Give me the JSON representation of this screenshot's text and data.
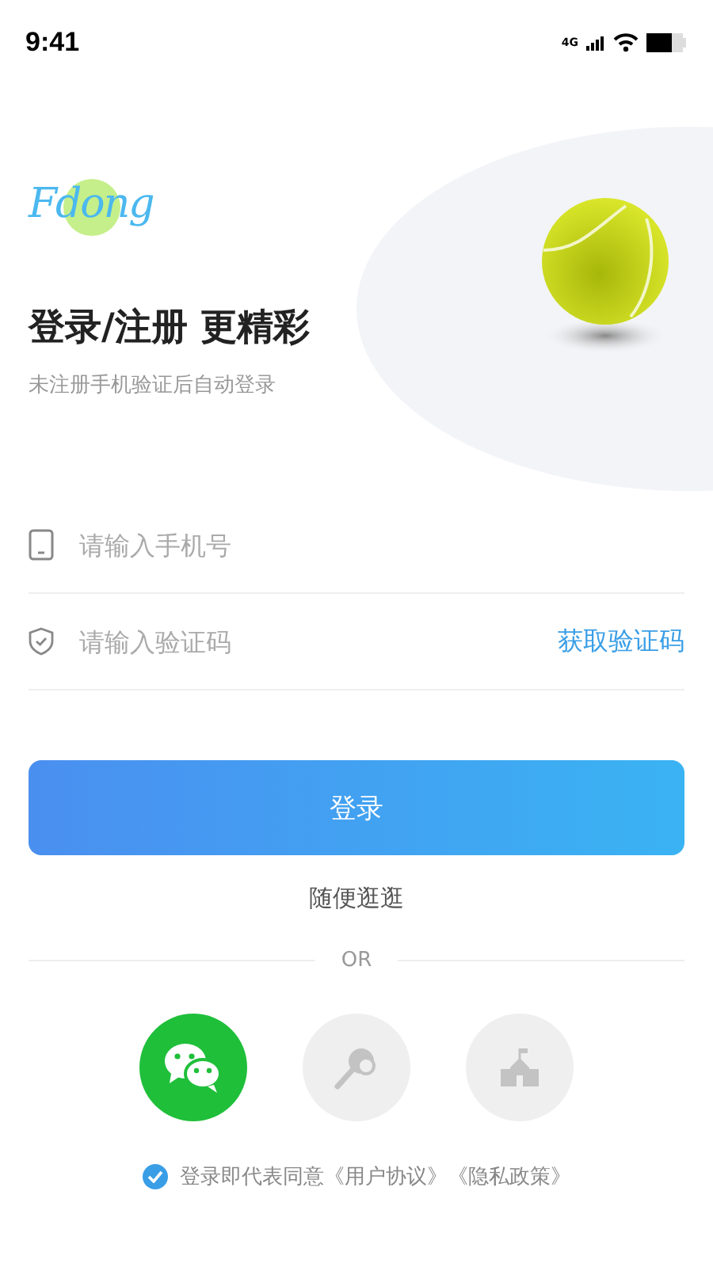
{
  "status_bar": {
    "time": "9:41",
    "network": "4G"
  },
  "logo": {
    "text": "Fdong"
  },
  "heading": "登录/注册 更精彩",
  "subtitle": "未注册手机验证后自动登录",
  "fields": [
    {
      "kind": "phone",
      "placeholder": "请输入手机号"
    },
    {
      "kind": "code",
      "placeholder": "请输入验证码",
      "action": "获取验证码"
    }
  ],
  "login_button": "登录",
  "browse_link": "随便逛逛",
  "divider_label": "OR",
  "social_logins": [
    {
      "kind": "wechat"
    },
    {
      "kind": "racket"
    },
    {
      "kind": "school"
    }
  ],
  "agreement": {
    "checked": true,
    "text": "登录即代表同意《用户协议》《隐私政策》"
  }
}
